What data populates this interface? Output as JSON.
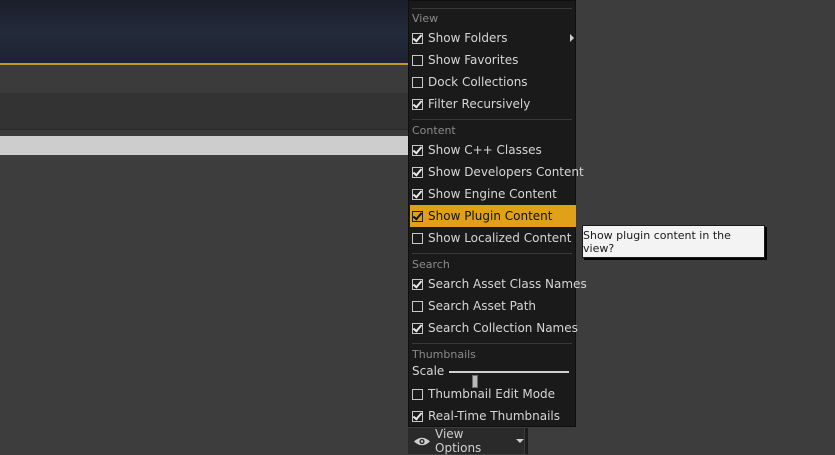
{
  "menu": {
    "sections": [
      {
        "header": "View",
        "items": [
          {
            "label": "Show Folders",
            "checked": true,
            "has_submenu": true
          },
          {
            "label": "Show Favorites",
            "checked": false
          },
          {
            "label": "Dock Collections",
            "checked": false
          },
          {
            "label": "Filter Recursively",
            "checked": true
          }
        ]
      },
      {
        "header": "Content",
        "items": [
          {
            "label": "Show C++ Classes",
            "checked": true
          },
          {
            "label": "Show Developers Content",
            "checked": true
          },
          {
            "label": "Show Engine Content",
            "checked": true
          },
          {
            "label": "Show Plugin Content",
            "checked": true,
            "highlighted": true
          },
          {
            "label": "Show Localized Content",
            "checked": false
          }
        ]
      },
      {
        "header": "Search",
        "items": [
          {
            "label": "Search Asset Class Names",
            "checked": true
          },
          {
            "label": "Search Asset Path",
            "checked": false
          },
          {
            "label": "Search Collection Names",
            "checked": true
          }
        ]
      },
      {
        "header": "Thumbnails",
        "scale": {
          "label": "Scale",
          "value": 0.2
        },
        "items": [
          {
            "label": "Thumbnail Edit Mode",
            "checked": false
          },
          {
            "label": "Real-Time Thumbnails",
            "checked": true
          }
        ]
      }
    ]
  },
  "view_options": {
    "label": "View Options",
    "icon": "eye-icon"
  },
  "tooltip": {
    "text": "Show plugin content in the view?"
  },
  "colors": {
    "highlight": "#e0a018",
    "viewport_border": "#c99a1a"
  }
}
